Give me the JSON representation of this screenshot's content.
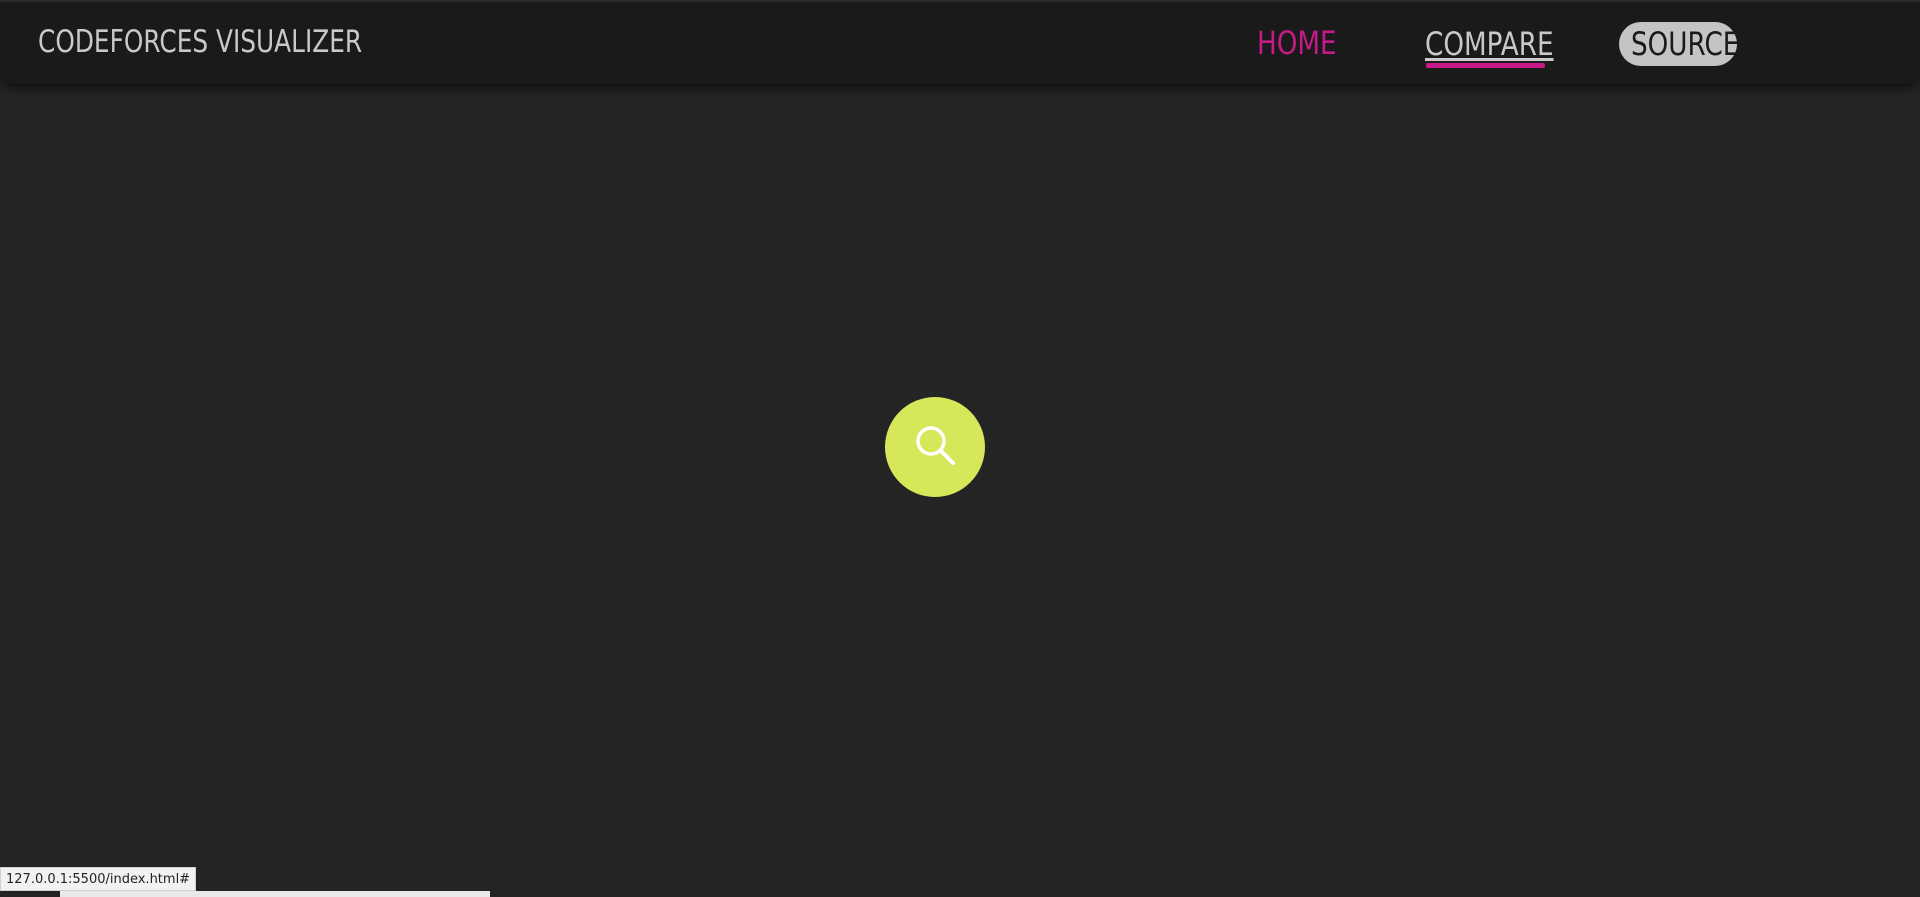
{
  "navbar": {
    "brand": "CODEFORCES VISUALIZER",
    "links": {
      "home": "HOME",
      "compare": "COMPARE",
      "source": "SOURCE"
    }
  },
  "main": {
    "search_button_icon": "search-icon"
  },
  "status_bar": {
    "url": "127.0.0.1:5500/index.html#"
  },
  "colors": {
    "accent": "#c61a88",
    "search_button": "#d6e75a",
    "background": "#242424",
    "navbar": "#1a1a1a"
  }
}
